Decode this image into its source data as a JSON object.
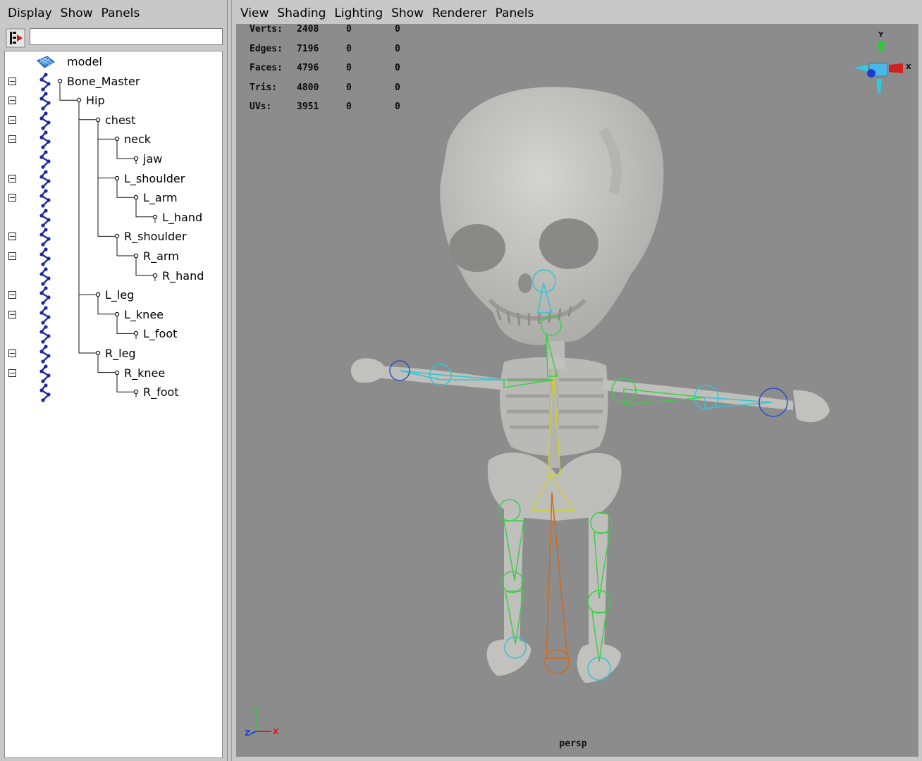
{
  "outliner": {
    "menu": [
      "Display",
      "Show",
      "Panels"
    ],
    "filter_value": "",
    "items": [
      {
        "label": "model",
        "type": "mesh",
        "depth": 0,
        "expander": false
      },
      {
        "label": "Bone_Master",
        "type": "joint",
        "depth": 0,
        "expander": true
      },
      {
        "label": "Hip",
        "type": "joint",
        "depth": 1,
        "expander": true
      },
      {
        "label": "chest",
        "type": "joint",
        "depth": 2,
        "expander": true
      },
      {
        "label": "neck",
        "type": "joint",
        "depth": 3,
        "expander": true
      },
      {
        "label": "jaw",
        "type": "joint",
        "depth": 4,
        "expander": false
      },
      {
        "label": "L_shoulder",
        "type": "joint",
        "depth": 3,
        "expander": true
      },
      {
        "label": "L_arm",
        "type": "joint",
        "depth": 4,
        "expander": true
      },
      {
        "label": "L_hand",
        "type": "joint",
        "depth": 5,
        "expander": false
      },
      {
        "label": "R_shoulder",
        "type": "joint",
        "depth": 3,
        "expander": true
      },
      {
        "label": "R_arm",
        "type": "joint",
        "depth": 4,
        "expander": true
      },
      {
        "label": "R_hand",
        "type": "joint",
        "depth": 5,
        "expander": false
      },
      {
        "label": "L_leg",
        "type": "joint",
        "depth": 2,
        "expander": true
      },
      {
        "label": "L_knee",
        "type": "joint",
        "depth": 3,
        "expander": true
      },
      {
        "label": "L_foot",
        "type": "joint",
        "depth": 4,
        "expander": false
      },
      {
        "label": "R_leg",
        "type": "joint",
        "depth": 2,
        "expander": true
      },
      {
        "label": "R_knee",
        "type": "joint",
        "depth": 3,
        "expander": true
      },
      {
        "label": "R_foot",
        "type": "joint",
        "depth": 4,
        "expander": false
      }
    ]
  },
  "viewport": {
    "menu": [
      "View",
      "Shading",
      "Lighting",
      "Show",
      "Renderer",
      "Panels"
    ],
    "hud": [
      {
        "label": "Verts:",
        "v1": "2408",
        "v2": "0",
        "v3": "0"
      },
      {
        "label": "Edges:",
        "v1": "7196",
        "v2": "0",
        "v3": "0"
      },
      {
        "label": "Faces:",
        "v1": "4796",
        "v2": "0",
        "v3": "0"
      },
      {
        "label": "Tris:",
        "v1": "4800",
        "v2": "0",
        "v3": "0"
      },
      {
        "label": "UVs:",
        "v1": "3951",
        "v2": "0",
        "v3": "0"
      }
    ],
    "camera": "persp",
    "view_cube": {
      "y": "Y",
      "x": "X"
    },
    "axis_gizmo": {
      "x": "X",
      "y": "Y",
      "z": "Z"
    }
  },
  "colors": {
    "viewport_bg": "#8c8c8c",
    "joint_icon": "#1c2aa0",
    "joint_green": "#3ecc4a",
    "joint_cyan": "#33c4d4",
    "joint_blue": "#2a50c8",
    "joint_yellow": "#d0d030",
    "joint_orange": "#d06a1a"
  }
}
